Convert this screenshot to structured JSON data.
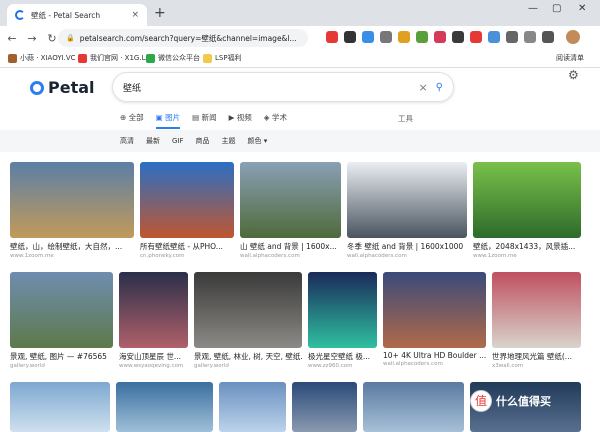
{
  "browser": {
    "tab_title": "壁纸 - Petal Search",
    "url": "petalsearch.com/search?query=壁纸&channel=image&l...",
    "bookmarks": [
      "小蒜 · XIAOYI.VC",
      "我们官网 · X1G.LA",
      "微信公众平台",
      "LSP福利"
    ],
    "reading_list": "阅读清单",
    "tab_close": "×",
    "new_tab": "+",
    "win_min": "—",
    "win_max": "▢",
    "win_close": "✕",
    "back": "←",
    "forward": "→",
    "reload": "↻",
    "lock": "🔒"
  },
  "logo": {
    "text": "Petal"
  },
  "search": {
    "query": "壁纸",
    "clear": "×",
    "submit": "⚲"
  },
  "settings": "⚙",
  "vertical_tabs": [
    {
      "label": "⊕ 全部"
    },
    {
      "label": "▣ 图片"
    },
    {
      "label": "▤ 新闻"
    },
    {
      "label": "▶ 视频"
    },
    {
      "label": "◈ 学术"
    }
  ],
  "tools": "工具",
  "filters": [
    "高清",
    "最新",
    "GIF",
    "商品",
    "主题",
    "颜色 ▾"
  ],
  "images": [
    {
      "title": "壁纸，山，绘制壁纸，大自然，...",
      "source": "www.1zoom.me",
      "c1": "#5b7fa6",
      "c2": "#c29a5a"
    },
    {
      "title": "所有壁纸壁纸 - 从PHO...",
      "source": "cn.phoneky.com",
      "c1": "#2a6fc4",
      "c2": "#c0562f"
    },
    {
      "title": "山 壁纸 and 背景 | 1600x...",
      "source": "wall.alphacoders.com",
      "c1": "#8aa0b5",
      "c2": "#4e6a3a"
    },
    {
      "title": "冬季 壁纸 and 背景 | 1600x1000",
      "source": "wall.alphacoders.com",
      "c1": "#eaeef2",
      "c2": "#4a5560"
    },
    {
      "title": "壁纸，2048x1433，风景插...",
      "source": "www.1zoom.me",
      "c1": "#7ac04a",
      "c2": "#2d6b2a"
    },
    {
      "title": "景观, 壁纸, 图片 — #76565",
      "source": "gallery.world",
      "c1": "#6f8db0",
      "c2": "#5d7a4a"
    },
    {
      "title": "海安山顶星辰 世...",
      "source": "www.wsyaoqeving.com",
      "c1": "#2a2f4a",
      "c2": "#b0606a"
    },
    {
      "title": "景观, 壁纸, 林业, 树, 天空, 壁纸...",
      "source": "gallery.world",
      "c1": "#3a3a3a",
      "c2": "#8c8a85"
    },
    {
      "title": "极光星空壁纸 极...",
      "source": "www.zz960.com",
      "c1": "#1a2a5a",
      "c2": "#2fc0a0"
    },
    {
      "title": "10+ 4K Ultra HD Boulder ...",
      "source": "wall.alphacoders.com",
      "c1": "#3a4a7a",
      "c2": "#b06a4a"
    },
    {
      "title": "世界地理风光篇 壁纸(...",
      "source": "x3wall.com",
      "c1": "#c05060",
      "c2": "#d8d4cc"
    },
    {
      "title": "",
      "source": "",
      "c1": "#7da8d0",
      "c2": "#cfe0ef"
    },
    {
      "title": "",
      "source": "",
      "c1": "#3a6fa0",
      "c2": "#9fc0d8"
    },
    {
      "title": "",
      "source": "",
      "c1": "#6a90c0",
      "c2": "#bcd3ea"
    },
    {
      "title": "",
      "source": "",
      "c1": "#2a4a7a",
      "c2": "#8a9ab0"
    },
    {
      "title": "",
      "source": "",
      "c1": "#5a7aa0",
      "c2": "#a8c0d8"
    },
    {
      "title": "",
      "source": "",
      "c1": "#203a5a",
      "c2": "#5a7090"
    }
  ],
  "watermark": {
    "icon": "值",
    "text": "什么值得买"
  }
}
